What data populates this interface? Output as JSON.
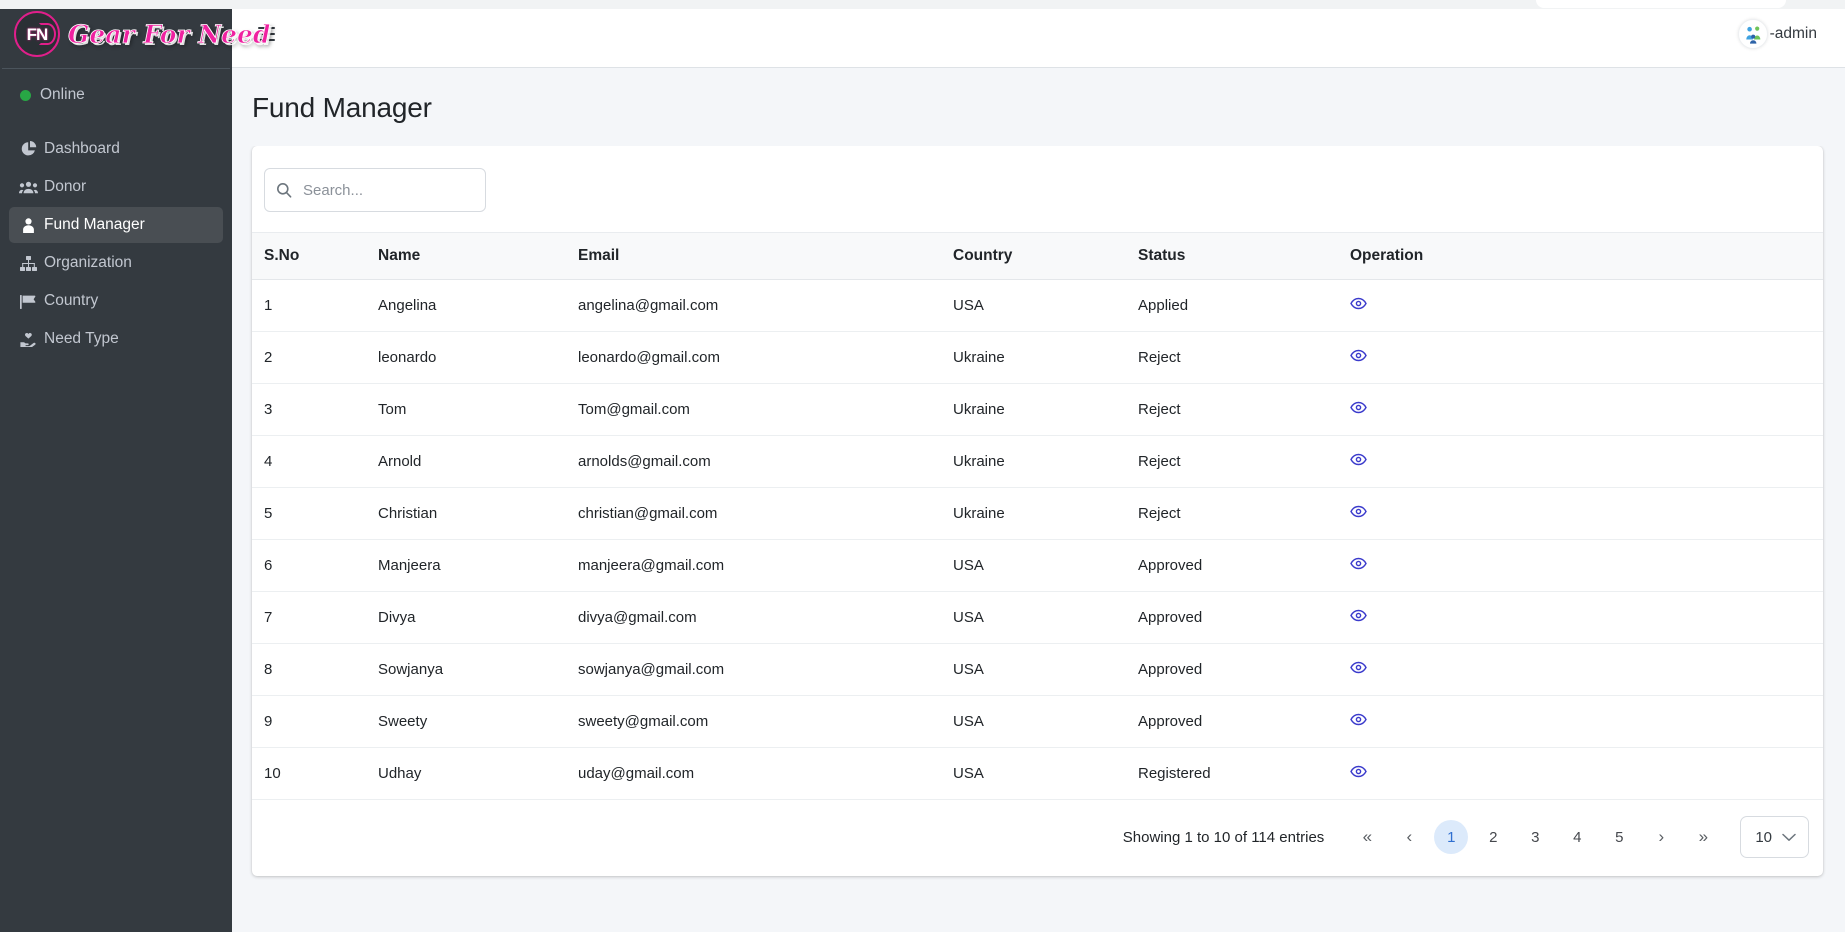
{
  "brand": {
    "logo_mark": "FN",
    "name": "Gear For Need",
    "logo_icon": "gear-for-need-logo"
  },
  "sidebar": {
    "status": {
      "label": "Online",
      "color": "#28a745",
      "icon": "online-dot-icon"
    },
    "items": [
      {
        "label": "Dashboard",
        "icon": "pie-chart-icon",
        "active": false
      },
      {
        "label": "Donor",
        "icon": "users-icon",
        "active": false
      },
      {
        "label": "Fund Manager",
        "icon": "user-tie-icon",
        "active": true
      },
      {
        "label": "Organization",
        "icon": "sitemap-icon",
        "active": false
      },
      {
        "label": "Country",
        "icon": "flag-icon",
        "active": false
      },
      {
        "label": "Need Type",
        "icon": "hand-holding-heart-icon",
        "active": false
      }
    ]
  },
  "topbar": {
    "menu_toggle_icon": "hamburger-icon",
    "user_label": "-admin",
    "avatar_icon": "user-avatar-icon"
  },
  "page": {
    "title": "Fund Manager"
  },
  "search": {
    "value": "",
    "placeholder": "Search...",
    "icon": "search-icon"
  },
  "table": {
    "columns": [
      "S.No",
      "Name",
      "Email",
      "Country",
      "Status",
      "Operation"
    ],
    "row_action_icon": "eye-icon",
    "row_action_color": "#3b3bcc",
    "rows": [
      {
        "sno": "1",
        "name": "Angelina",
        "email": "angelina@gmail.com",
        "country": "USA",
        "status": "Applied"
      },
      {
        "sno": "2",
        "name": "leonardo",
        "email": "leonardo@gmail.com",
        "country": "Ukraine",
        "status": "Reject"
      },
      {
        "sno": "3",
        "name": "Tom",
        "email": "Tom@gmail.com",
        "country": "Ukraine",
        "status": "Reject"
      },
      {
        "sno": "4",
        "name": "Arnold",
        "email": "arnolds@gmail.com",
        "country": "Ukraine",
        "status": "Reject"
      },
      {
        "sno": "5",
        "name": "Christian",
        "email": "christian@gmail.com",
        "country": "Ukraine",
        "status": "Reject"
      },
      {
        "sno": "6",
        "name": "Manjeera",
        "email": "manjeera@gmail.com",
        "country": "USA",
        "status": "Approved"
      },
      {
        "sno": "7",
        "name": "Divya",
        "email": "divya@gmail.com",
        "country": "USA",
        "status": "Approved"
      },
      {
        "sno": "8",
        "name": "Sowjanya",
        "email": "sowjanya@gmail.com",
        "country": "USA",
        "status": "Approved"
      },
      {
        "sno": "9",
        "name": "Sweety",
        "email": "sweety@gmail.com",
        "country": "USA",
        "status": "Approved"
      },
      {
        "sno": "10",
        "name": "Udhay",
        "email": "uday@gmail.com",
        "country": "USA",
        "status": "Registered"
      }
    ]
  },
  "pagination": {
    "info": "Showing 1 to 10 of 114 entries",
    "first_label": "«",
    "prev_label": "‹",
    "pages": [
      "1",
      "2",
      "3",
      "4",
      "5"
    ],
    "active_page": "1",
    "next_label": "›",
    "last_label": "»",
    "page_size": "10",
    "page_size_icon": "chevron-down-icon",
    "active_color": "#dceafb"
  }
}
